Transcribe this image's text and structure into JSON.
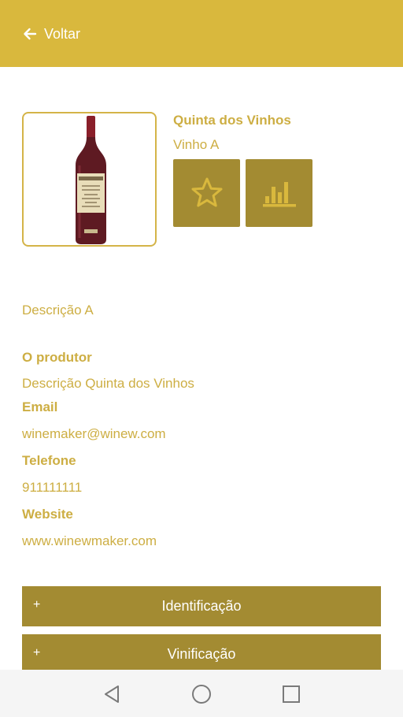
{
  "header": {
    "back_label": "Voltar"
  },
  "product": {
    "producer": "Quinta dos Vinhos",
    "wine": "Vinho A",
    "description": "Descrição A"
  },
  "producer_section": {
    "title": "O produtor",
    "description": "Descrição Quinta dos Vinhos",
    "email_label": "Email",
    "email": "winemaker@winew.com",
    "phone_label": "Telefone",
    "phone": "911111111",
    "website_label": "Website",
    "website": "www.winewmaker.com"
  },
  "accordions": [
    {
      "icon": "+",
      "label": "Identificação"
    },
    {
      "icon": "+",
      "label": "Vinificação"
    }
  ],
  "icons": {
    "back": "arrow-left-icon",
    "favorite": "star-outline-icon",
    "stats": "bar-chart-icon",
    "nav_back": "triangle-back-icon",
    "nav_home": "circle-home-icon",
    "nav_recent": "square-recent-icon"
  },
  "colors": {
    "header": "#d9b83d",
    "accent_text": "#cdae43",
    "button_dark": "#a38b32",
    "button_icon": "#d9b83d"
  }
}
